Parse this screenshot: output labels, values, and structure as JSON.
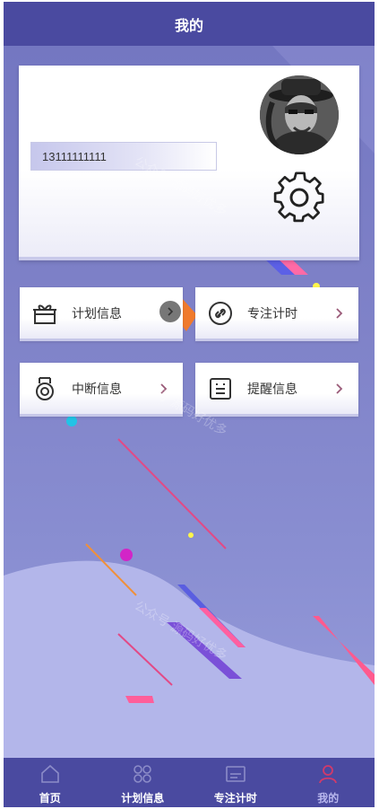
{
  "header": {
    "title": "我的"
  },
  "profile": {
    "phone": "13111111111",
    "avatar_icon": "avatar-photo",
    "settings_icon": "gear-icon"
  },
  "menu": [
    {
      "label": "计划信息",
      "icon": "gift-icon"
    },
    {
      "label": "专注计时",
      "icon": "link-icon"
    },
    {
      "label": "中断信息",
      "icon": "medal-icon"
    },
    {
      "label": "提醒信息",
      "icon": "note-icon"
    }
  ],
  "tabbar": [
    {
      "label": "首页",
      "icon": "home-icon",
      "active": false
    },
    {
      "label": "计划信息",
      "icon": "grid-icon",
      "active": false
    },
    {
      "label": "专注计时",
      "icon": "timer-icon",
      "active": false
    },
    {
      "label": "我的",
      "icon": "user-icon",
      "active": true
    }
  ],
  "watermark": "公众号 源码好优多",
  "colors": {
    "header": "#4a4aa0",
    "tabbar": "#4a4aa0",
    "active_tab": "#b9b8ee",
    "chevron": "#9a5a78"
  }
}
